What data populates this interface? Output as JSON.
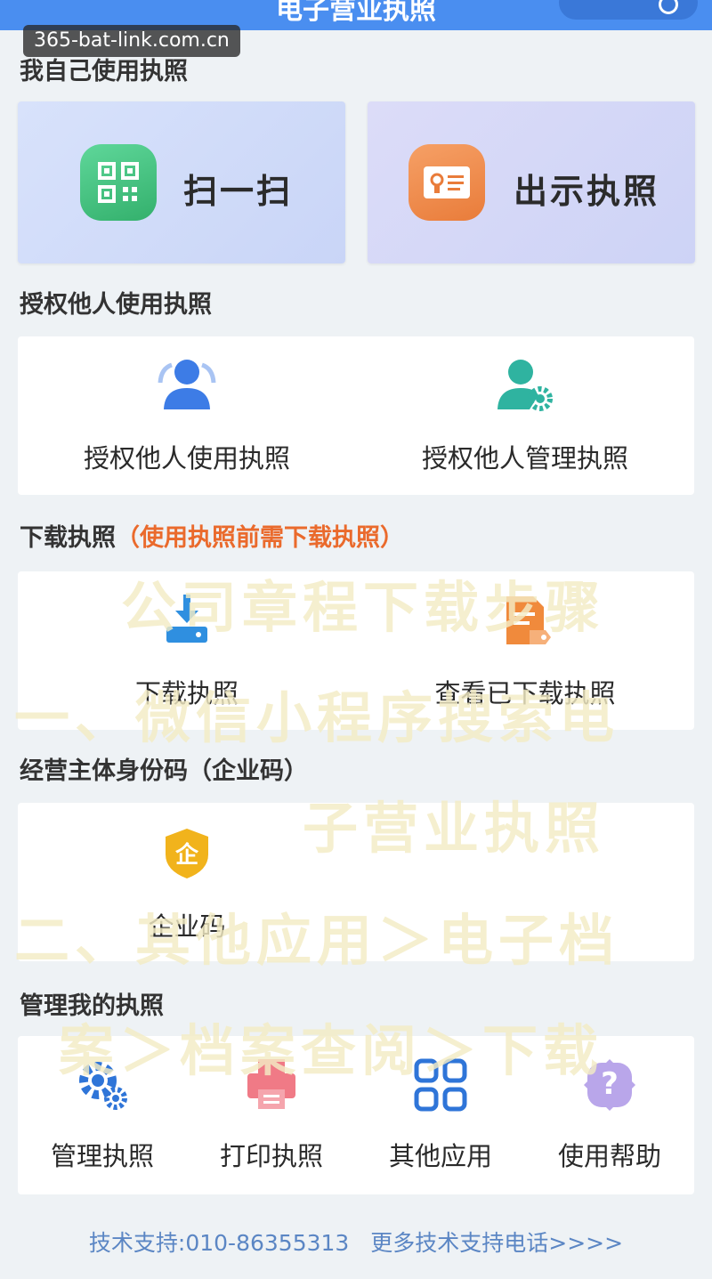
{
  "app": {
    "title": "电子营业执照"
  },
  "watermark_label": "365-bat-link.com.cn",
  "sections": {
    "self_use": "我自己使用执照",
    "authorize": "授权他人使用执照",
    "download": "下载执照",
    "download_note": "（使用执照前需下载执照）",
    "identity_code": "经营主体身份码（企业码）",
    "manage": "管理我的执照"
  },
  "quick_actions": {
    "scan": "扫一扫",
    "show_license": "出示执照"
  },
  "authorize_items": [
    {
      "label": "授权他人使用执照",
      "icon": "person-icon"
    },
    {
      "label": "授权他人管理执照",
      "icon": "person-gear-icon"
    }
  ],
  "download_items": [
    {
      "label": "下载执照",
      "icon": "download-icon"
    },
    {
      "label": "查看已下载执照",
      "icon": "document-tag-icon"
    }
  ],
  "identity_items": [
    {
      "label": "企业码",
      "icon": "enterprise-shield-icon",
      "badge": "企"
    }
  ],
  "manage_items": [
    {
      "label": "管理执照",
      "icon": "gear-icon"
    },
    {
      "label": "打印执照",
      "icon": "printer-icon"
    },
    {
      "label": "其他应用",
      "icon": "apps-grid-icon"
    },
    {
      "label": "使用帮助",
      "icon": "help-icon",
      "glyph": "?"
    }
  ],
  "footer": {
    "support": "技术支持:010-86355313",
    "more": "更多技术支持电话>>>>"
  },
  "overlay_text": [
    "公司章程下载步骤",
    "一、微信小程序搜索电",
    "子营业执照",
    "二、其他应用＞电子档",
    "案＞档案查阅＞下载"
  ],
  "colors": {
    "header_blue": "#4a8ef0",
    "scan_green": "#3fc17a",
    "license_orange": "#ef8a48",
    "note_orange": "#ea6a2c",
    "footer_link": "#5b86c4"
  }
}
